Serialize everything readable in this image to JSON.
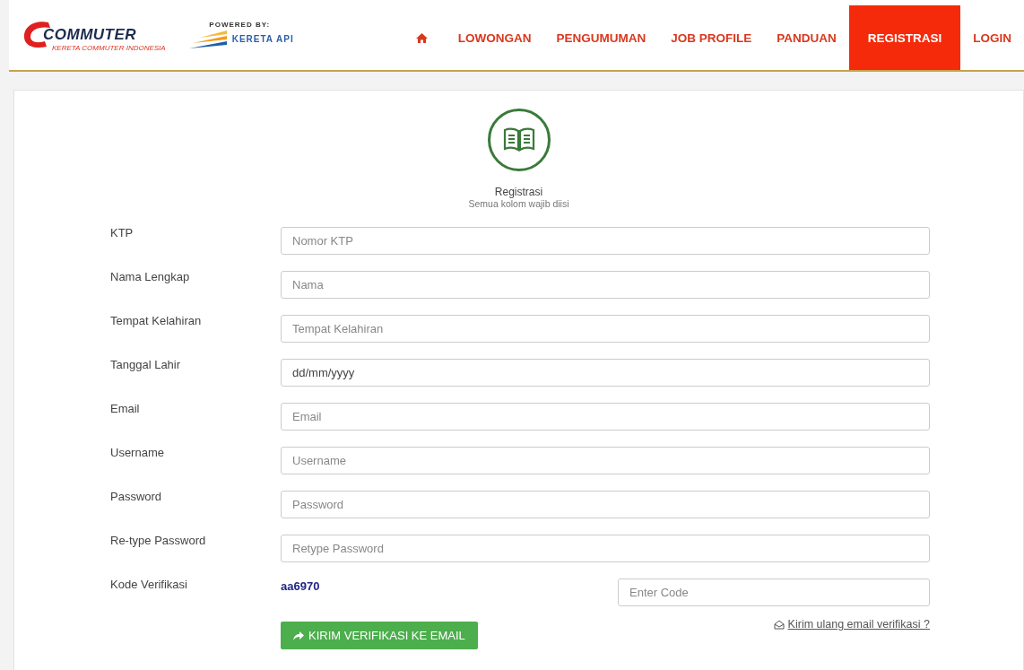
{
  "header": {
    "logo": {
      "name": "COMMUTER",
      "tagline": "KERETA COMMUTER INDONESIA"
    },
    "powered_by": {
      "label": "POWERED BY:",
      "name": "KERETA API"
    },
    "nav": [
      {
        "kind": "home",
        "selected": false
      },
      {
        "label": "LOWONGAN",
        "selected": false
      },
      {
        "label": "PENGUMUMAN",
        "selected": false
      },
      {
        "label": "JOB PROFILE",
        "selected": false
      },
      {
        "label": "PANDUAN",
        "selected": false
      },
      {
        "label": "REGISTRASI",
        "selected": true
      },
      {
        "label": "LOGIN",
        "selected": false
      }
    ]
  },
  "form": {
    "title": "Registrasi",
    "subtitle": "Semua kolom wajib diisi",
    "fields": [
      {
        "label": "KTP",
        "placeholder": "Nomor KTP"
      },
      {
        "label": "Nama Lengkap",
        "placeholder": "Nama"
      },
      {
        "label": "Tempat Kelahiran",
        "placeholder": "Tempat Kelahiran"
      },
      {
        "label": "Tanggal Lahir",
        "value": "dd/mm/yyyy"
      },
      {
        "label": "Email",
        "placeholder": "Email"
      },
      {
        "label": "Username",
        "placeholder": "Username"
      },
      {
        "label": "Password",
        "placeholder": "Password"
      },
      {
        "label": "Re-type Password",
        "placeholder": "Retype Password"
      }
    ],
    "verification": {
      "label": "Kode Verifikasi",
      "captcha": "aa6970",
      "placeholder": "Enter Code"
    },
    "send_button": "KIRIM VERIFIKASI KE EMAIL",
    "resend_link": "Kirim ulang email verifikasi ?"
  }
}
